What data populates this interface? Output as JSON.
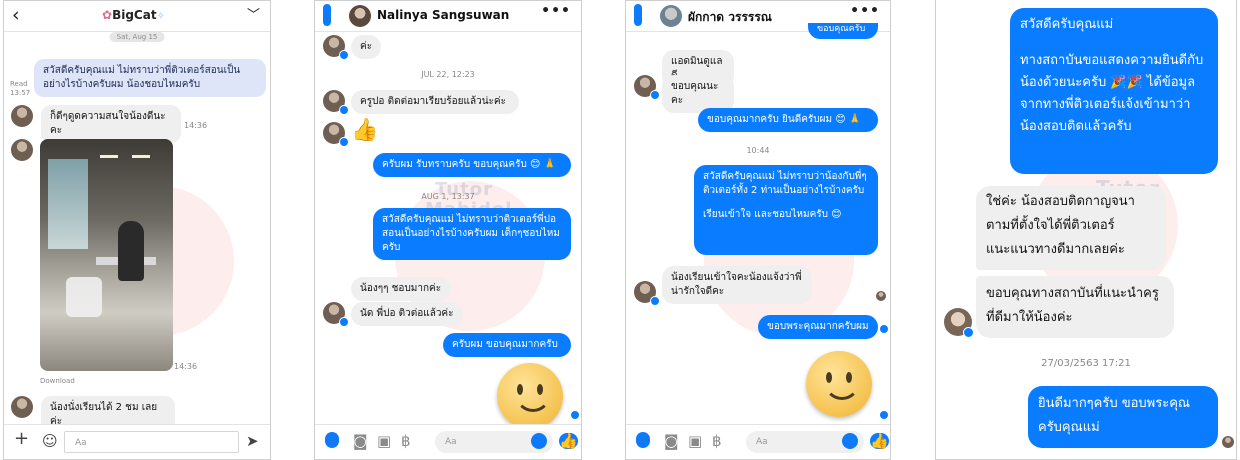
{
  "panel1": {
    "title": "BigCat",
    "date_pill": "Sat, Aug 15",
    "read_label": "Read",
    "read_time": "13:57",
    "msg_out_1": "สวัสดีครับคุณแม่ ไม่ทราบว่าพี่ติวเตอร์สอนเป็นอย่างไรบ้างครับผม น้องชอบไหมครับ",
    "msg_in_1": "ก็ดีๆดูดความสนใจน้องดีนะคะ",
    "msg_in_1_time": "14:36",
    "photo_time": "14:36",
    "download_label": "Download",
    "msg_in_2": "น้องนั่งเรียนได้ 2 ชม เลยค่ะ",
    "input_placeholder": "Aa"
  },
  "panel2": {
    "title": "Nalinya Sangsuwan",
    "msg_in_top": "ค่ะ",
    "stamp_1": "JUL 22, 12:23",
    "msg_in_1": "ครูปอ ติดต่อมาเรียบร้อยแล้วน่ะค่ะ",
    "msg_out_1": "ครับผม รับทราบครับ ขอบคุณครับ 😊 🙏",
    "stamp_2": "AUG 1, 13:37",
    "msg_out_2": "สวัสดีครับคุณแม่ ไม่ทราบว่าติวเตอร์พี่ปอสอนเป็นอย่างไรบ้างครับผม เด็กๆชอบไหมครับ",
    "msg_in_2": "น้องๆๆ ชอบมากค่ะ",
    "msg_in_3": "นัด พี่ปอ ติวต่อแล้วค่ะ",
    "msg_out_3": "ครับผม ขอบคุณมากครับ",
    "input_placeholder": "Aa"
  },
  "panel3": {
    "title": "ผักกาด วรรรรณ",
    "msg_out_top": "ขอบคุณครับ",
    "msg_in_1": "แอดมินดูแลดี",
    "msg_in_2": "ขอบคุณนะคะ",
    "msg_out_1": "ขอบคุณมากครับ ยินดีครับผม 😊 🙏",
    "stamp_1": "10:44",
    "msg_out_2a": "สวัสดีครับคุณแม่ ไม่ทราบว่าน้องกับพี่ๆติวเตอร์ทั้ง 2 ท่านเป็นอย่างไรบ้างครับ",
    "msg_out_2b": "เรียนเข้าใจ และชอบไหมครับ 😊",
    "msg_in_3": "น้องเรียนเข้าใจคะน้องแจ้งว่าพี่น่ารักใจดีคะ",
    "msg_out_3": "ขอบพระคุณมากครับผม",
    "input_placeholder": "Aa"
  },
  "panel4": {
    "msg_out_1": "สวัสดีครับคุณแม่",
    "msg_out_1b": "ทางสถาบันขอแสดงความยินดีกับน้องด้วยนะครับ 🎉🎉 ได้ข้อมูลจากทางพี่ติวเตอร์แจ้งเข้ามาว่าน้องสอบติดแล้วครับ",
    "msg_in_1": "ใช่ค่ะ น้องสอบติดกาญจนา ตามที่ตั้งใจได้พี่ติวเตอร์แนะแนวทางดีมากเลยค่ะ",
    "msg_in_2": "ขอบคุณทางสถาบันที่แนะนำครูที่ดีมาให้น้องค่ะ",
    "stamp_1": "27/03/2563 17:21",
    "msg_out_2": "ยินดีมากๆครับ ขอบพระคุณครับคุณแม่"
  },
  "watermark": {
    "line1": "Tutor",
    "line2": "Mahidol"
  },
  "colors": {
    "messenger_blue": "#0a7cff",
    "bubble_gray": "#efefef",
    "lavender": "#dfe5f8"
  }
}
